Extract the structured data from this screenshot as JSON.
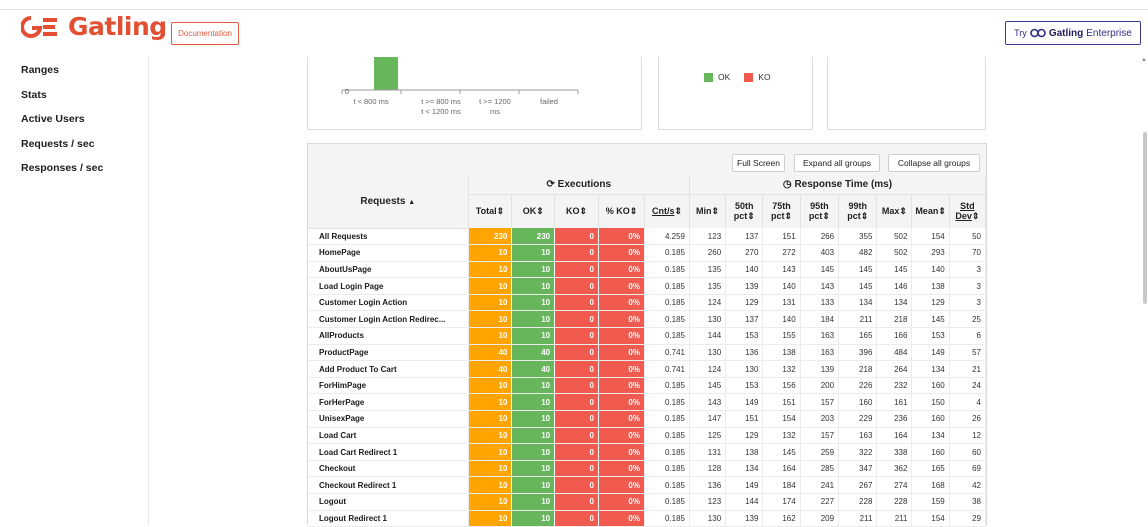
{
  "header": {
    "logo_text": "Gatling",
    "documentation_label": "Documentation",
    "enterprise_try": "Try",
    "enterprise_brand": "Gatling",
    "enterprise_suffix": "Enterprise"
  },
  "sidebar": {
    "items": [
      {
        "label": "Ranges"
      },
      {
        "label": "Stats"
      },
      {
        "label": "Active Users"
      },
      {
        "label": "Requests / sec"
      },
      {
        "label": "Responses / sec"
      }
    ]
  },
  "distribution_chart": {
    "y_tick_zero": "0",
    "categories": [
      {
        "line1": "t < 800 ms",
        "line2": ""
      },
      {
        "line1": "t >= 800 ms",
        "line2": "t < 1200 ms"
      },
      {
        "line1": "t >= 1200",
        "line2": "ms"
      },
      {
        "line1": "failed",
        "line2": ""
      }
    ]
  },
  "pie_legend": {
    "ok_label": "OK",
    "ko_label": "KO",
    "ok_color": "#68b65c",
    "ko_color": "#f15b4f"
  },
  "table_toolbar": {
    "full_screen": "Full Screen",
    "expand_all": "Expand all groups",
    "collapse_all": "Collapse all groups"
  },
  "table": {
    "requests_header": "Requests",
    "executions_header": "Executions",
    "response_time_header": "Response Time (ms)",
    "columns": {
      "total": "Total",
      "ok": "OK",
      "ko": "KO",
      "ko_pct": "% KO",
      "cnt": "Cnt/s",
      "min": "Min",
      "p50a": "50th",
      "p50b": "pct",
      "p75a": "75th",
      "p75b": "pct",
      "p95a": "95th",
      "p95b": "pct",
      "p99a": "99th",
      "p99b": "pct",
      "max": "Max",
      "mean": "Mean",
      "std_a": "Std",
      "std_b": "Dev"
    },
    "rows": [
      {
        "name": "All Requests",
        "total": "230",
        "ok": "230",
        "ko": "0",
        "ko_pct": "0%",
        "cnt": "4.259",
        "min": "123",
        "p50": "137",
        "p75": "151",
        "p95": "266",
        "p99": "355",
        "max": "502",
        "mean": "154",
        "std": "50"
      },
      {
        "name": "HomePage",
        "total": "10",
        "ok": "10",
        "ko": "0",
        "ko_pct": "0%",
        "cnt": "0.185",
        "min": "260",
        "p50": "270",
        "p75": "272",
        "p95": "403",
        "p99": "482",
        "max": "502",
        "mean": "293",
        "std": "70"
      },
      {
        "name": "AboutUsPage",
        "total": "10",
        "ok": "10",
        "ko": "0",
        "ko_pct": "0%",
        "cnt": "0.185",
        "min": "135",
        "p50": "140",
        "p75": "143",
        "p95": "145",
        "p99": "145",
        "max": "145",
        "mean": "140",
        "std": "3"
      },
      {
        "name": "Load Login Page",
        "total": "10",
        "ok": "10",
        "ko": "0",
        "ko_pct": "0%",
        "cnt": "0.185",
        "min": "135",
        "p50": "139",
        "p75": "140",
        "p95": "143",
        "p99": "145",
        "max": "146",
        "mean": "138",
        "std": "3"
      },
      {
        "name": "Customer Login Action",
        "total": "10",
        "ok": "10",
        "ko": "0",
        "ko_pct": "0%",
        "cnt": "0.185",
        "min": "124",
        "p50": "129",
        "p75": "131",
        "p95": "133",
        "p99": "134",
        "max": "134",
        "mean": "129",
        "std": "3"
      },
      {
        "name": "Customer Login Action Redirec...",
        "total": "10",
        "ok": "10",
        "ko": "0",
        "ko_pct": "0%",
        "cnt": "0.185",
        "min": "130",
        "p50": "137",
        "p75": "140",
        "p95": "184",
        "p99": "211",
        "max": "218",
        "mean": "145",
        "std": "25"
      },
      {
        "name": "AllProducts",
        "total": "10",
        "ok": "10",
        "ko": "0",
        "ko_pct": "0%",
        "cnt": "0.185",
        "min": "144",
        "p50": "153",
        "p75": "155",
        "p95": "163",
        "p99": "165",
        "max": "166",
        "mean": "153",
        "std": "6"
      },
      {
        "name": "ProductPage",
        "total": "40",
        "ok": "40",
        "ko": "0",
        "ko_pct": "0%",
        "cnt": "0.741",
        "min": "130",
        "p50": "136",
        "p75": "138",
        "p95": "163",
        "p99": "396",
        "max": "484",
        "mean": "149",
        "std": "57"
      },
      {
        "name": "Add Product To Cart",
        "total": "40",
        "ok": "40",
        "ko": "0",
        "ko_pct": "0%",
        "cnt": "0.741",
        "min": "124",
        "p50": "130",
        "p75": "132",
        "p95": "139",
        "p99": "218",
        "max": "264",
        "mean": "134",
        "std": "21"
      },
      {
        "name": "ForHimPage",
        "total": "10",
        "ok": "10",
        "ko": "0",
        "ko_pct": "0%",
        "cnt": "0.185",
        "min": "145",
        "p50": "153",
        "p75": "156",
        "p95": "200",
        "p99": "226",
        "max": "232",
        "mean": "160",
        "std": "24"
      },
      {
        "name": "ForHerPage",
        "total": "10",
        "ok": "10",
        "ko": "0",
        "ko_pct": "0%",
        "cnt": "0.185",
        "min": "143",
        "p50": "149",
        "p75": "151",
        "p95": "157",
        "p99": "160",
        "max": "161",
        "mean": "150",
        "std": "4"
      },
      {
        "name": "UnisexPage",
        "total": "10",
        "ok": "10",
        "ko": "0",
        "ko_pct": "0%",
        "cnt": "0.185",
        "min": "147",
        "p50": "151",
        "p75": "154",
        "p95": "203",
        "p99": "229",
        "max": "236",
        "mean": "160",
        "std": "26"
      },
      {
        "name": "Load Cart",
        "total": "10",
        "ok": "10",
        "ko": "0",
        "ko_pct": "0%",
        "cnt": "0.185",
        "min": "125",
        "p50": "129",
        "p75": "132",
        "p95": "157",
        "p99": "163",
        "max": "164",
        "mean": "134",
        "std": "12"
      },
      {
        "name": "Load Cart Redirect 1",
        "total": "10",
        "ok": "10",
        "ko": "0",
        "ko_pct": "0%",
        "cnt": "0.185",
        "min": "131",
        "p50": "138",
        "p75": "145",
        "p95": "259",
        "p99": "322",
        "max": "338",
        "mean": "160",
        "std": "60"
      },
      {
        "name": "Checkout",
        "total": "10",
        "ok": "10",
        "ko": "0",
        "ko_pct": "0%",
        "cnt": "0.185",
        "min": "128",
        "p50": "134",
        "p75": "164",
        "p95": "285",
        "p99": "347",
        "max": "362",
        "mean": "165",
        "std": "69"
      },
      {
        "name": "Checkout Redirect 1",
        "total": "10",
        "ok": "10",
        "ko": "0",
        "ko_pct": "0%",
        "cnt": "0.185",
        "min": "136",
        "p50": "149",
        "p75": "184",
        "p95": "241",
        "p99": "267",
        "max": "274",
        "mean": "168",
        "std": "42"
      },
      {
        "name": "Logout",
        "total": "10",
        "ok": "10",
        "ko": "0",
        "ko_pct": "0%",
        "cnt": "0.185",
        "min": "123",
        "p50": "144",
        "p75": "174",
        "p95": "227",
        "p99": "228",
        "max": "228",
        "mean": "159",
        "std": "38"
      },
      {
        "name": "Logout Redirect 1",
        "total": "10",
        "ok": "10",
        "ko": "0",
        "ko_pct": "0%",
        "cnt": "0.185",
        "min": "130",
        "p50": "139",
        "p75": "162",
        "p95": "209",
        "p99": "211",
        "max": "211",
        "mean": "154",
        "std": "29"
      }
    ]
  }
}
